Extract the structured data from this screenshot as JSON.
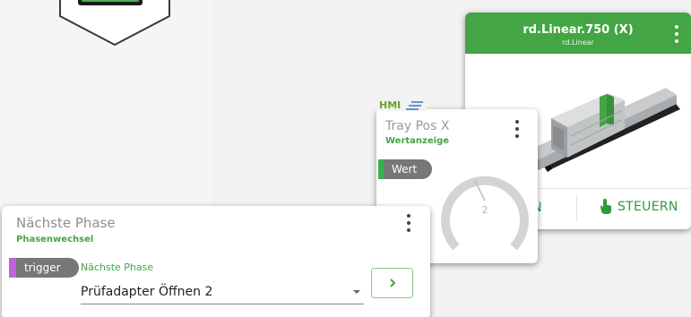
{
  "linear_card": {
    "title": "rd.Linear.750 (X)",
    "subtitle": "rd.Linear",
    "action_left_label": "EN",
    "action_right_label": "STEUERN",
    "accent": "#43a544"
  },
  "tray_card": {
    "badge": "HMI",
    "title": "Tray Pos X",
    "subtitle": "Wertanzeige",
    "tag": "Wert",
    "gauge_value": "2"
  },
  "phase_card": {
    "title": "Nächste Phase",
    "subtitle": "Phasenwechsel",
    "tag": "trigger",
    "field_label": "Nächste Phase",
    "select_value": "Prüfadapter Öffnen 2",
    "go_icon": "chevron-right-icon"
  },
  "colors": {
    "green": "#43a544",
    "tag_gray": "#777777",
    "trigger_accent": "#c362d9",
    "hmi_blue": "#3f7fbf"
  }
}
